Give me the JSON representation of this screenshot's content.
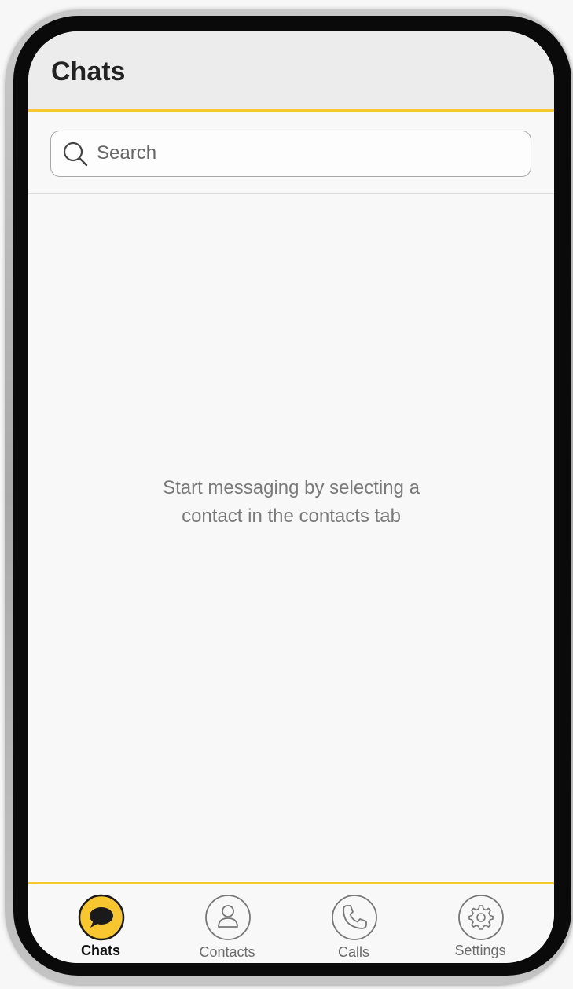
{
  "header": {
    "title": "Chats"
  },
  "search": {
    "placeholder": "Search"
  },
  "empty_state": {
    "line1": "Start messaging by selecting a",
    "line2": "contact in the contacts tab"
  },
  "tabs": [
    {
      "label": "Chats",
      "icon": "chat-bubble-icon",
      "active": true
    },
    {
      "label": "Contacts",
      "icon": "person-icon",
      "active": false
    },
    {
      "label": "Calls",
      "icon": "phone-icon",
      "active": false
    },
    {
      "label": "Settings",
      "icon": "gear-icon",
      "active": false
    }
  ],
  "colors": {
    "accent": "#f7c630",
    "header_bg": "#ececec",
    "background": "#f8f8f8"
  }
}
